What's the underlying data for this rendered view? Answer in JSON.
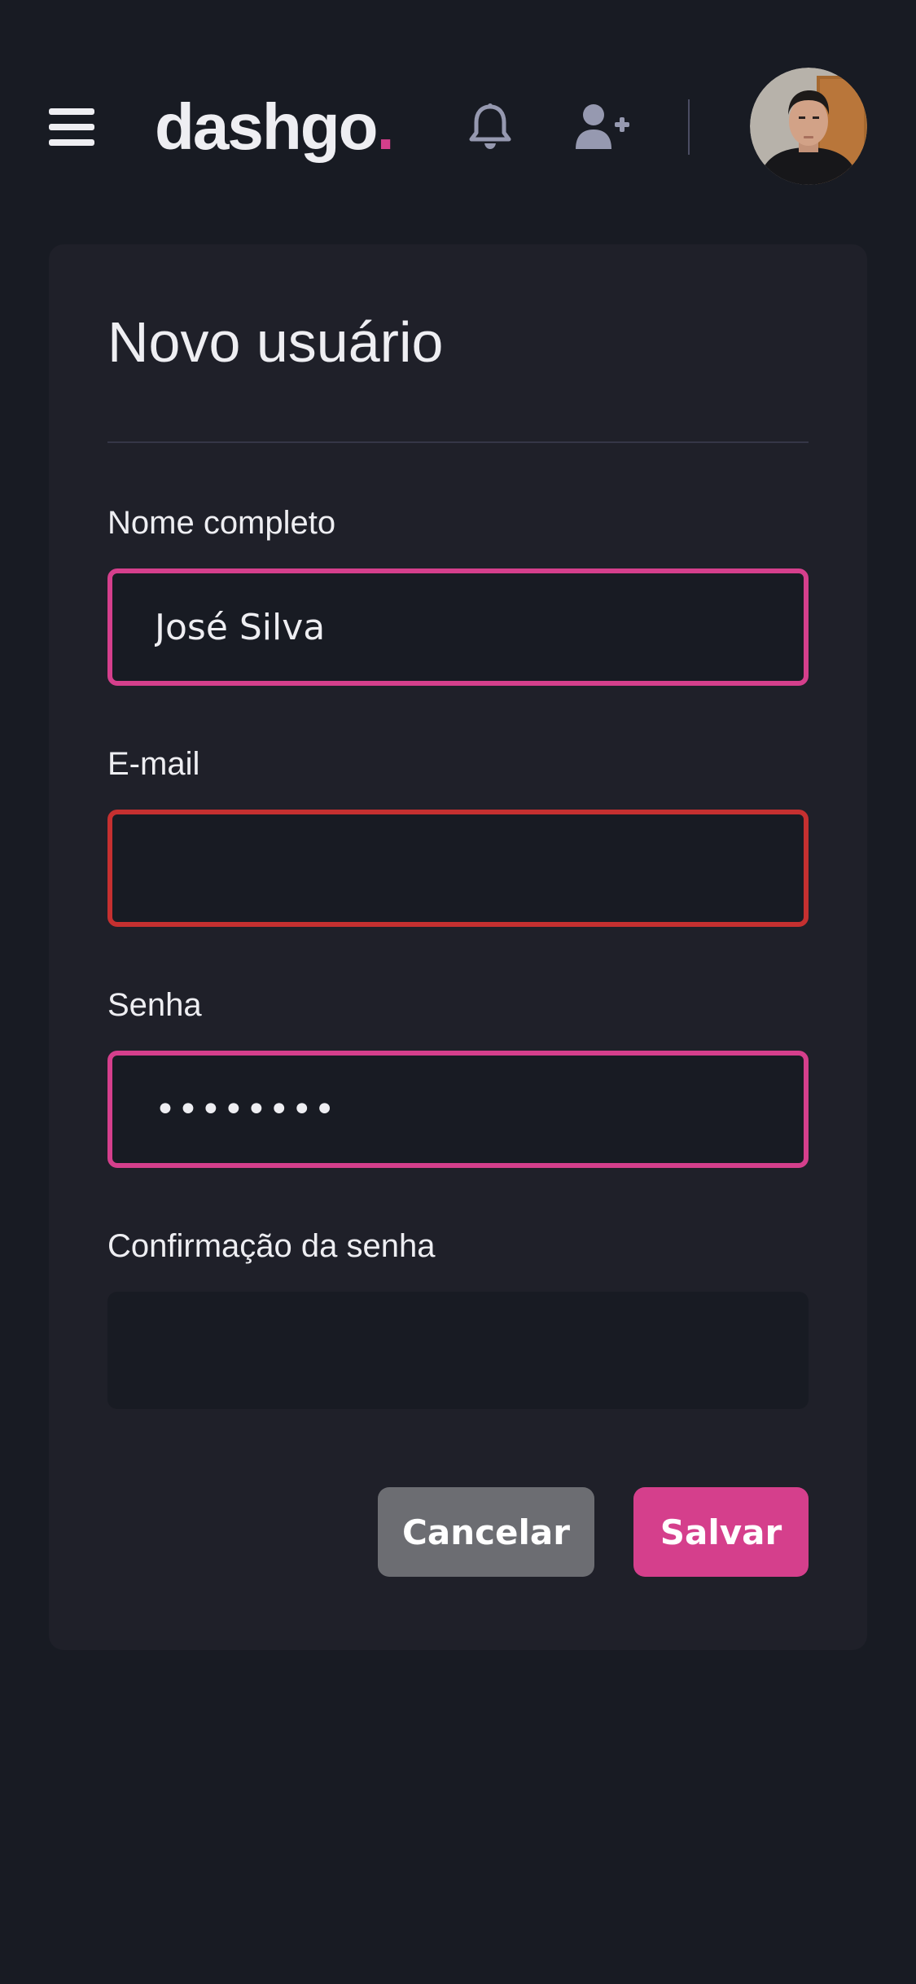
{
  "header": {
    "logo_text": "dashgo",
    "logo_dot": ".",
    "icons": {
      "menu": "hamburger-menu-icon",
      "notifications": "bell-icon",
      "add_user": "user-plus-icon"
    },
    "avatar": "user-avatar-photo"
  },
  "form": {
    "title": "Novo usuário",
    "fields": {
      "name": {
        "label": "Nome completo",
        "value": "José Silva",
        "state": "focus"
      },
      "email": {
        "label": "E-mail",
        "value": "",
        "state": "error"
      },
      "password": {
        "label": "Senha",
        "value": "••••••••",
        "state": "focus"
      },
      "password_confirmation": {
        "label": "Confirmação da senha",
        "value": "",
        "state": "default"
      }
    },
    "buttons": {
      "cancel": "Cancelar",
      "save": "Salvar"
    }
  },
  "colors": {
    "background": "#181b23",
    "card": "#1f2029",
    "accent": "#d53f8c",
    "error": "#c53030",
    "cancel_button": "#6c6d72",
    "icon_gray": "#9699b0"
  }
}
